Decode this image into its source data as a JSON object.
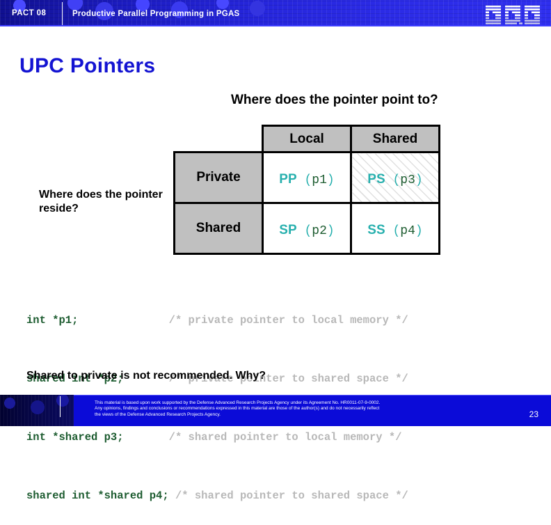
{
  "banner": {
    "conference": "PACT 08",
    "subject": "Productive Parallel Programming in PGAS",
    "logo_text": "IBM",
    "bg_color": "#1a1ad0"
  },
  "slide": {
    "title": "UPC Pointers",
    "title_color": "#1414d2"
  },
  "matrix": {
    "question_top": "Where does the pointer point to?",
    "question_left": "Where does the pointer reside?",
    "corner_label": "",
    "column_headers": [
      "Local",
      "Shared"
    ],
    "row_headers": [
      "Private",
      "Shared"
    ],
    "header_bg": "#c0c0c0",
    "tag_color": "#28b0ae",
    "var_color": "#1d5c30",
    "cells": [
      [
        {
          "tag": "PP",
          "var": "p1",
          "hatched": false
        },
        {
          "tag": "PS",
          "var": "p3",
          "hatched": true
        }
      ],
      [
        {
          "tag": "SP",
          "var": "p2",
          "hatched": false
        },
        {
          "tag": "SS",
          "var": "p4",
          "hatched": false
        }
      ]
    ]
  },
  "code": {
    "color_decl": "#1d5c30",
    "color_comment": "#b8b8b8",
    "lines": [
      {
        "decl": "int *p1;              ",
        "comment": "/* private pointer to local memory */"
      },
      {
        "decl": "shared int *p2;       ",
        "comment": "/* private pointer to shared space */"
      },
      {
        "decl": "int *shared p3;       ",
        "comment": "/* shared pointer to local memory */"
      },
      {
        "decl": "shared int *shared p4; ",
        "comment": "/* shared pointer to shared space */"
      }
    ]
  },
  "bottom_note": "Shared to private is not recommended.  Why?",
  "footer": {
    "line1": "This material is based upon work supported by the Defense Advanced Research Projects Agency under its Agreement No. HR0011-07-9-0002.",
    "line2": "Any opinions, findings and conclusions or recommendations expressed in this material are those of the  author(s) and do not necessarily reflect",
    "line3": "the views of the Defense Advanced Research Projects Agency.",
    "page_number": "23",
    "bg_color": "#0b0bd8"
  }
}
